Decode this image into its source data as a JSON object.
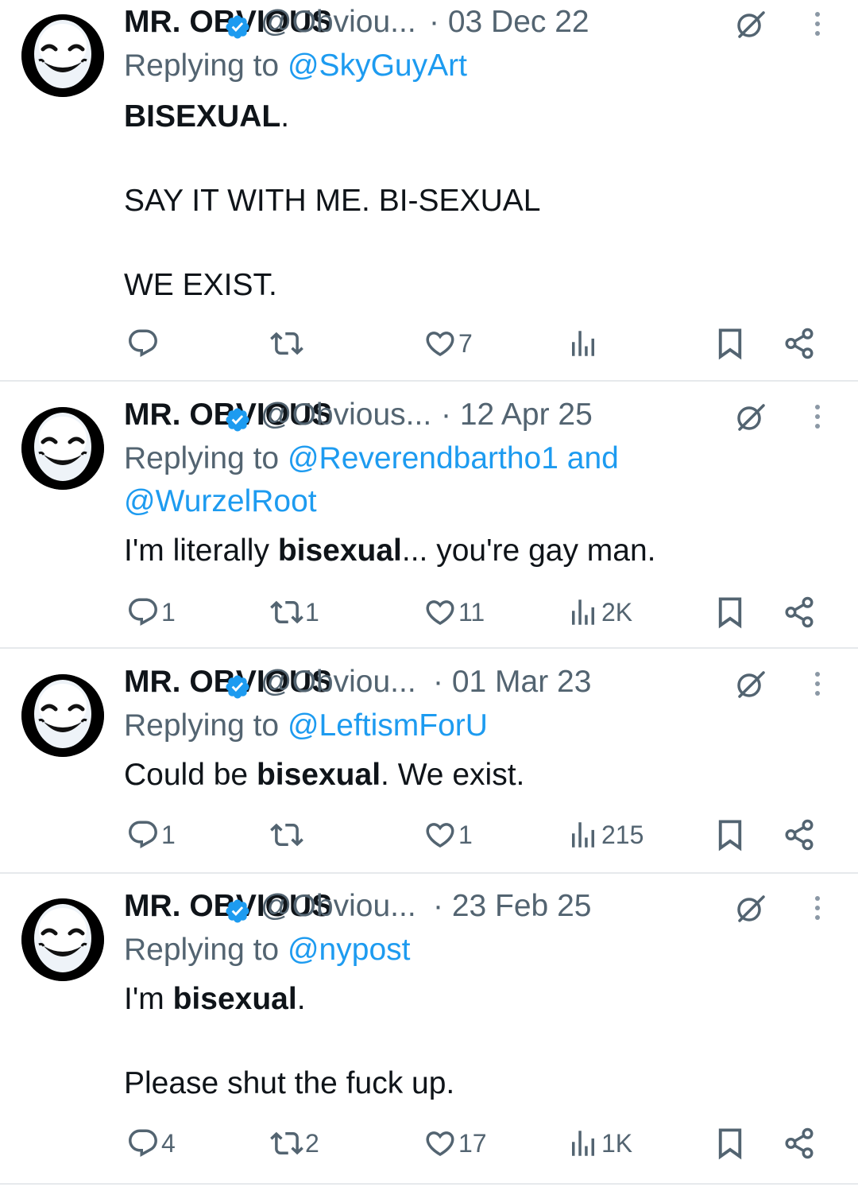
{
  "tweets": [
    {
      "name": "MR. OBVIOUS",
      "handle": "@Obviou...",
      "date": "· 03 Dec 22",
      "replying_prefix": "Replying to",
      "replying_lines": [
        "@SkyGuyArt"
      ],
      "body": [
        [
          {
            "t": "BISEXUAL",
            "b": true
          },
          {
            "t": "."
          }
        ],
        [],
        [
          {
            "t": "SAY IT WITH ME. BI-SEXUAL"
          }
        ],
        [],
        [
          {
            "t": "WE EXIST."
          }
        ]
      ],
      "counts": {
        "reply": "",
        "retweet": "",
        "like": "7",
        "views": ""
      }
    },
    {
      "name": "MR. OBVIOUS",
      "handle": "@Obvious...",
      "date": "· 12 Apr 25",
      "replying_prefix": "Replying to",
      "replying_lines": [
        "@Reverendbartho1 and",
        "@WurzelRoot"
      ],
      "body": [
        [
          {
            "t": "I'm literally "
          },
          {
            "t": "bisexual",
            "b": true
          },
          {
            "t": "... you're gay man."
          }
        ]
      ],
      "counts": {
        "reply": "1",
        "retweet": "1",
        "like": "11",
        "views": "2K"
      }
    },
    {
      "name": "MR. OBVIOUS",
      "handle": "@Obviou...",
      "date": "· 01 Mar 23",
      "replying_prefix": "Replying to",
      "replying_lines": [
        "@LeftismForU"
      ],
      "body": [
        [
          {
            "t": "Could be "
          },
          {
            "t": "bisexual",
            "b": true
          },
          {
            "t": ". We exist."
          }
        ]
      ],
      "counts": {
        "reply": "1",
        "retweet": "",
        "like": "1",
        "views": "215"
      }
    },
    {
      "name": "MR. OBVIOUS",
      "handle": "@Obviou...",
      "date": "· 23 Feb 25",
      "replying_prefix": "Replying to",
      "replying_lines": [
        "@nypost"
      ],
      "body": [
        [
          {
            "t": "I'm "
          },
          {
            "t": "bisexual",
            "b": true
          },
          {
            "t": "."
          }
        ],
        [],
        [
          {
            "t": "Please shut the fuck up."
          }
        ]
      ],
      "counts": {
        "reply": "4",
        "retweet": "2",
        "like": "17",
        "views": "1K"
      }
    }
  ],
  "icons": {
    "avatar": "smiling-mask-avatar",
    "verified": "verified-badge-icon",
    "grok": "grok-icon",
    "more": "more-options-icon",
    "reply": "reply-icon",
    "retweet": "retweet-icon",
    "like": "heart-icon",
    "views": "views-icon",
    "bookmark": "bookmark-icon",
    "share": "share-icon"
  },
  "colors": {
    "text": "#0f1419",
    "secondary": "#536471",
    "link": "#1d9bf0",
    "divider": "#e6e9ec"
  }
}
